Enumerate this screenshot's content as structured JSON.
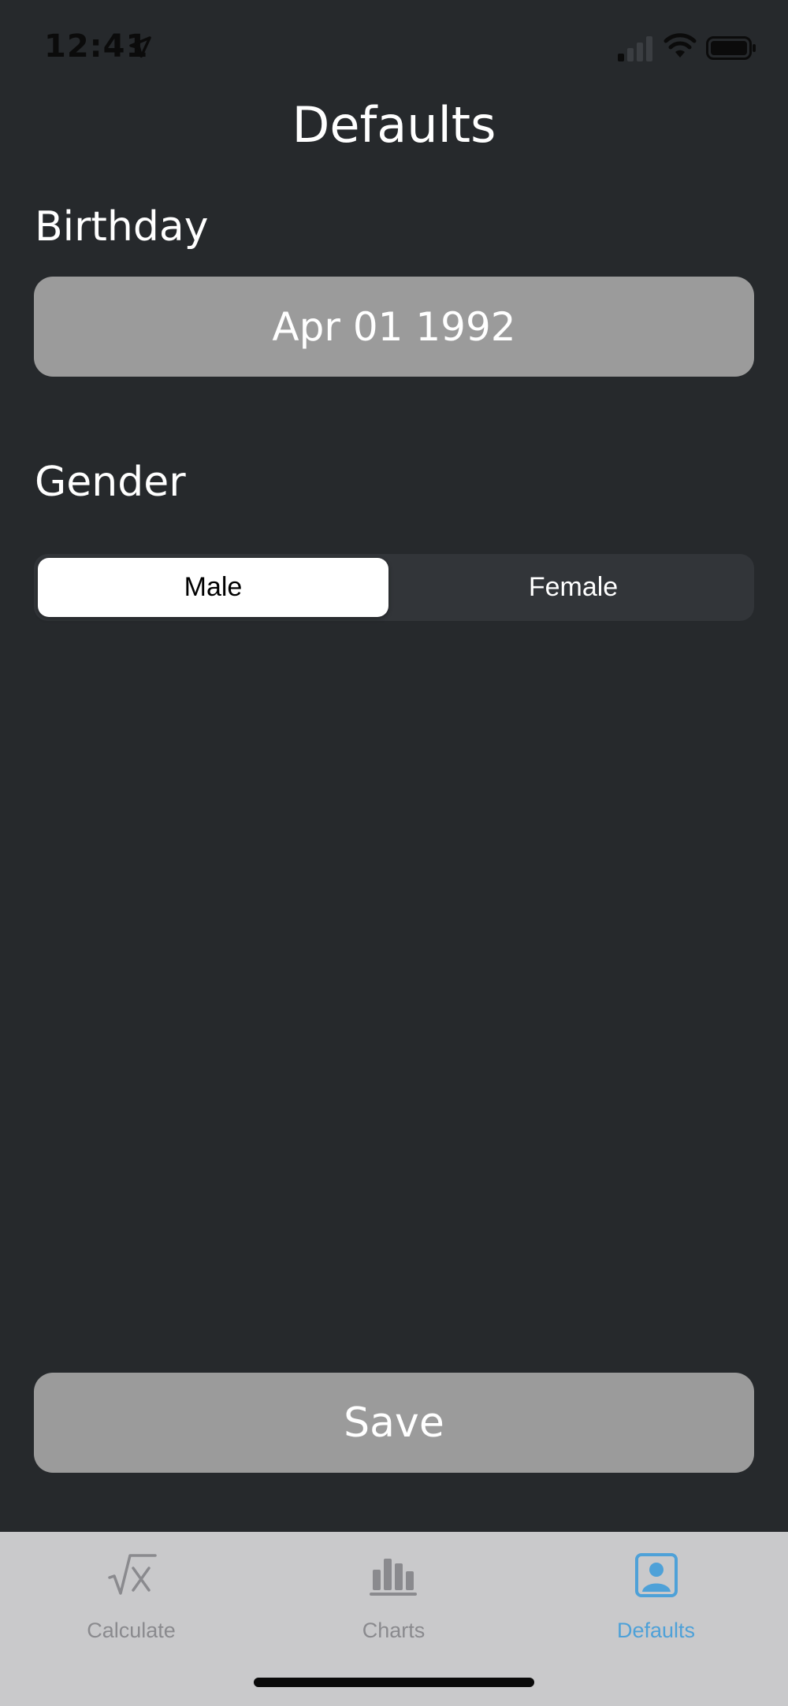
{
  "status_bar": {
    "time": "12:41"
  },
  "page": {
    "title": "Defaults"
  },
  "birthday": {
    "label": "Birthday",
    "value": "Apr 01 1992"
  },
  "gender": {
    "label": "Gender",
    "options": [
      "Male",
      "Female"
    ],
    "selected": "Male"
  },
  "save": {
    "label": "Save"
  },
  "tab_bar": {
    "tabs": [
      {
        "label": "Calculate",
        "icon": "square-root-icon",
        "active": false
      },
      {
        "label": "Charts",
        "icon": "bar-chart-icon",
        "active": false
      },
      {
        "label": "Defaults",
        "icon": "person-icon",
        "active": true
      }
    ]
  },
  "colors": {
    "background": "#26292c",
    "field": "#9b9b9b",
    "accent": "#4ea1d8",
    "tab_inactive": "#8a8a8e",
    "tab_bar": "#c9c9cb"
  }
}
